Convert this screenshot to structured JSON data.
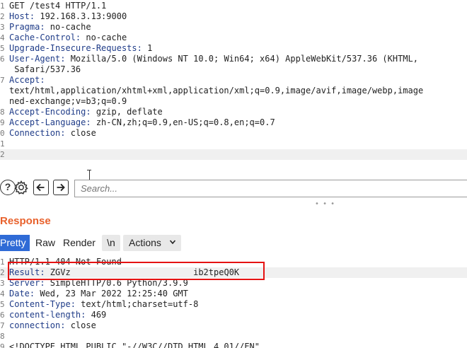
{
  "request": {
    "lines": [
      {
        "n": "1",
        "key": "",
        "val": "GET /test4 HTTP/1.1"
      },
      {
        "n": "2",
        "key": "Host:",
        "val": " 192.168.3.13:9000"
      },
      {
        "n": "3",
        "key": "Pragma:",
        "val": " no-cache"
      },
      {
        "n": "4",
        "key": "Cache-Control:",
        "val": " no-cache"
      },
      {
        "n": "5",
        "key": "Upgrade-Insecure-Requests:",
        "val": " 1"
      },
      {
        "n": "6",
        "key": "User-Agent:",
        "val": " Mozilla/5.0 (Windows NT 10.0; Win64; x64) AppleWebKit/537.36 (KHTML,"
      },
      {
        "n": "",
        "key": "",
        "val": " Safari/537.36"
      },
      {
        "n": "7",
        "key": "Accept:",
        "val": ""
      },
      {
        "n": "",
        "key": "",
        "val": "text/html,application/xhtml+xml,application/xml;q=0.9,image/avif,image/webp,image"
      },
      {
        "n": "",
        "key": "",
        "val": "ned-exchange;v=b3;q=0.9"
      },
      {
        "n": "8",
        "key": "Accept-Encoding:",
        "val": " gzip, deflate"
      },
      {
        "n": "9",
        "key": "Accept-Language:",
        "val": " zh-CN,zh;q=0.9,en-US;q=0.8,en;q=0.7"
      },
      {
        "n": "0",
        "key": "Connection:",
        "val": " close"
      },
      {
        "n": "1",
        "key": "",
        "val": ""
      },
      {
        "n": "2",
        "key": "",
        "val": ""
      }
    ]
  },
  "toolbar": {
    "help_glyph": "?",
    "search_placeholder": "Search..."
  },
  "response": {
    "title": "Response",
    "tabs": {
      "pretty": "Pretty",
      "raw": "Raw",
      "render": "Render",
      "newline": "\\n",
      "actions": "Actions"
    },
    "lines": [
      {
        "n": "1",
        "key": "",
        "val": "HTTP/1.1 404 Not Found"
      },
      {
        "n": "2",
        "key": "Result:",
        "val": " ZGVz                        ib2tpeQ0K"
      },
      {
        "n": "3",
        "key": "Server:",
        "val": " SimpleHTTP/0.6 Python/3.9.9"
      },
      {
        "n": "4",
        "key": "Date:",
        "val": " Wed, 23 Mar 2022 12:25:40 GMT"
      },
      {
        "n": "5",
        "key": "Content-Type:",
        "val": " text/html;charset=utf-8"
      },
      {
        "n": "6",
        "key": "content-length:",
        "val": " 469"
      },
      {
        "n": "7",
        "key": "connection:",
        "val": " close"
      },
      {
        "n": "8",
        "key": "",
        "val": ""
      },
      {
        "n": "9",
        "key": "",
        "val": "<!DOCTYPE HTML PUBLIC \"-//W3C//DTD HTML 4.01//EN\""
      }
    ]
  },
  "colors": {
    "accent": "#2f6bd6",
    "response_title": "#e8612c",
    "highlight_box": "#e51212",
    "header_key": "#1f3c88"
  }
}
